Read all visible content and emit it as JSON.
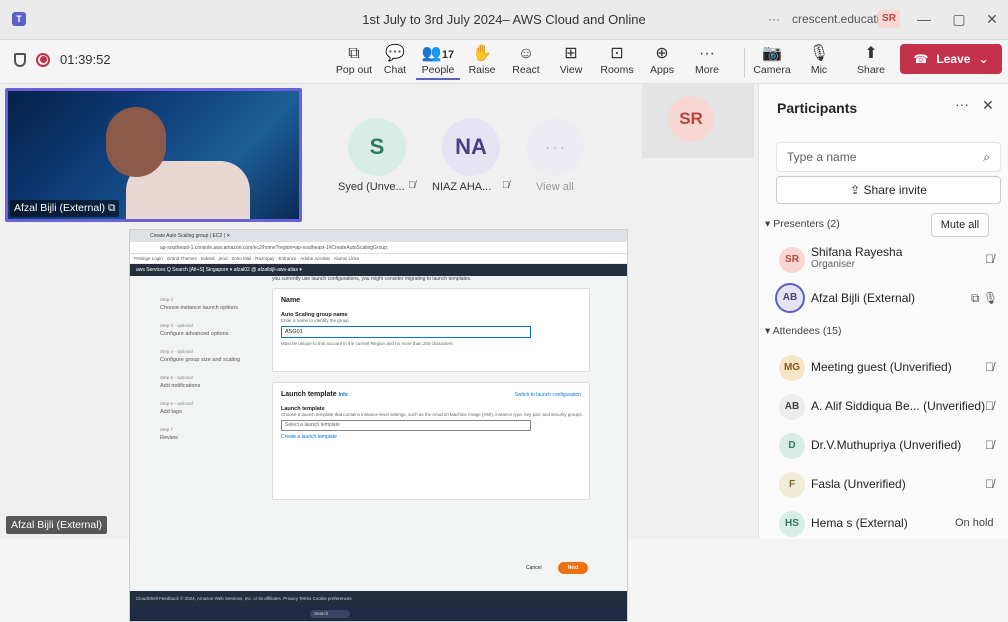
{
  "window": {
    "title": "1st July to 3rd July 2024– AWS Cloud and Online",
    "account": "crescent.education",
    "account_initials": "SR"
  },
  "meeting": {
    "timer": "01:39:52",
    "people_count": "17"
  },
  "toolbar": {
    "pop_out": "Pop out",
    "chat": "Chat",
    "people": "People",
    "raise": "Raise",
    "react": "React",
    "view": "View",
    "rooms": "Rooms",
    "apps": "Apps",
    "more": "More",
    "camera": "Camera",
    "mic": "Mic",
    "share": "Share",
    "leave": "Leave"
  },
  "stage": {
    "main_video_name": "Afzal Bijli (External)",
    "bottom_name": "Afzal Bijli (External)",
    "sr_tile_initials": "SR",
    "tiles": [
      {
        "initials": "S",
        "label": "Syed (Unve...",
        "bg": "#d8ede6",
        "fg": "#2a7a5c"
      },
      {
        "initials": "NA",
        "label": "NIAZ AHA...",
        "bg": "#e6e3f3",
        "fg": "#4a4280"
      },
      {
        "initials": "· · ·",
        "label": "View all",
        "bg": "#ececf2",
        "fg": "#999"
      }
    ]
  },
  "screen_share": {
    "tab": "Create Auto Scaling group | EC2 | ✕",
    "url": "ap-southeast-1.console.aws.amazon.com/ec2/home?region=ap-southeast-1#CreateAutoScalingGroup:",
    "bookmarks": "Prestige Login · Grand Themes · Indeed · prod · Zoho Mail · Razorpay · Entrance · Adobe Acrobat · Alumni Links",
    "aws_nav": "aws   Services   Q Search                [Alt+S]        Singapore ▾     afzal02 @ afzalbijli-aws-alias ▾",
    "steps": [
      {
        "num": "Step 2",
        "label": "Choose instance launch options"
      },
      {
        "num": "Step 3 - optional",
        "label": "Configure advanced options"
      },
      {
        "num": "Step 4 - optional",
        "label": "Configure group size and scaling"
      },
      {
        "num": "Step 5 - optional",
        "label": "Add notifications"
      },
      {
        "num": "Step 6 - optional",
        "label": "Add tags"
      },
      {
        "num": "Step 7",
        "label": "Review"
      }
    ],
    "intro": "you currently use launch configurations, you might consider migrating to launch templates.",
    "name_card_title": "Name",
    "asg_label": "Auto Scaling group name",
    "asg_hint": "Enter a name to identify the group.",
    "asg_value": "ASG01",
    "asg_rule": "Must be unique to this account in the current Region and no more than 255 characters.",
    "lt_card_title": "Launch template",
    "lt_info": "Info",
    "switch_link": "Switch to launch configuration",
    "lt_label": "Launch template",
    "lt_hint": "Choose a launch template that contains instance-level settings, such as the Amazon Machine Image (AMI), instance type, key pair, and security groups.",
    "lt_placeholder": "Select a launch template",
    "create_lt": "Create a launch template",
    "cancel": "Cancel",
    "next": "Next",
    "footer": "CloudShell   Feedback                                      © 2024, Amazon Web Services, Inc. or its affiliates.   Privacy   Terms   Cookie preferences",
    "taskbar_search": "Search"
  },
  "panel": {
    "title": "Participants",
    "search_placeholder": "Type a name",
    "share_invite": "Share invite",
    "presenters_header": "Presenters (2)",
    "mute_all": "Mute all",
    "attendees_header": "Attendees (15)",
    "presenters": [
      {
        "initials": "SR",
        "name": "Shifana Rayesha",
        "role": "Organiser",
        "bg": "#f8d6d2",
        "fg": "#b7473c"
      },
      {
        "initials": "AB",
        "name": "Afzal Bijli (External)",
        "bg": "#e6e3f3",
        "fg": "#4a4280"
      }
    ],
    "attendees": [
      {
        "initials": "MG",
        "name": "Meeting guest (Unverified)",
        "bg": "#f5e4c8",
        "fg": "#8a5a12"
      },
      {
        "initials": "AB",
        "name": "A. Alif Siddiqua Be... (Unverified)",
        "bg": "#ececec",
        "fg": "#444"
      },
      {
        "initials": "D",
        "name": "Dr.V.Muthupriya (Unverified)",
        "bg": "#d8ede6",
        "fg": "#2a7a5c"
      },
      {
        "initials": "F",
        "name": "Fasla (Unverified)",
        "bg": "#f0ecd8",
        "fg": "#7a6a22"
      },
      {
        "initials": "HS",
        "name": "Hema s (External)",
        "status": "On hold",
        "bg": "#d8ede6",
        "fg": "#2a7a5c"
      }
    ]
  }
}
